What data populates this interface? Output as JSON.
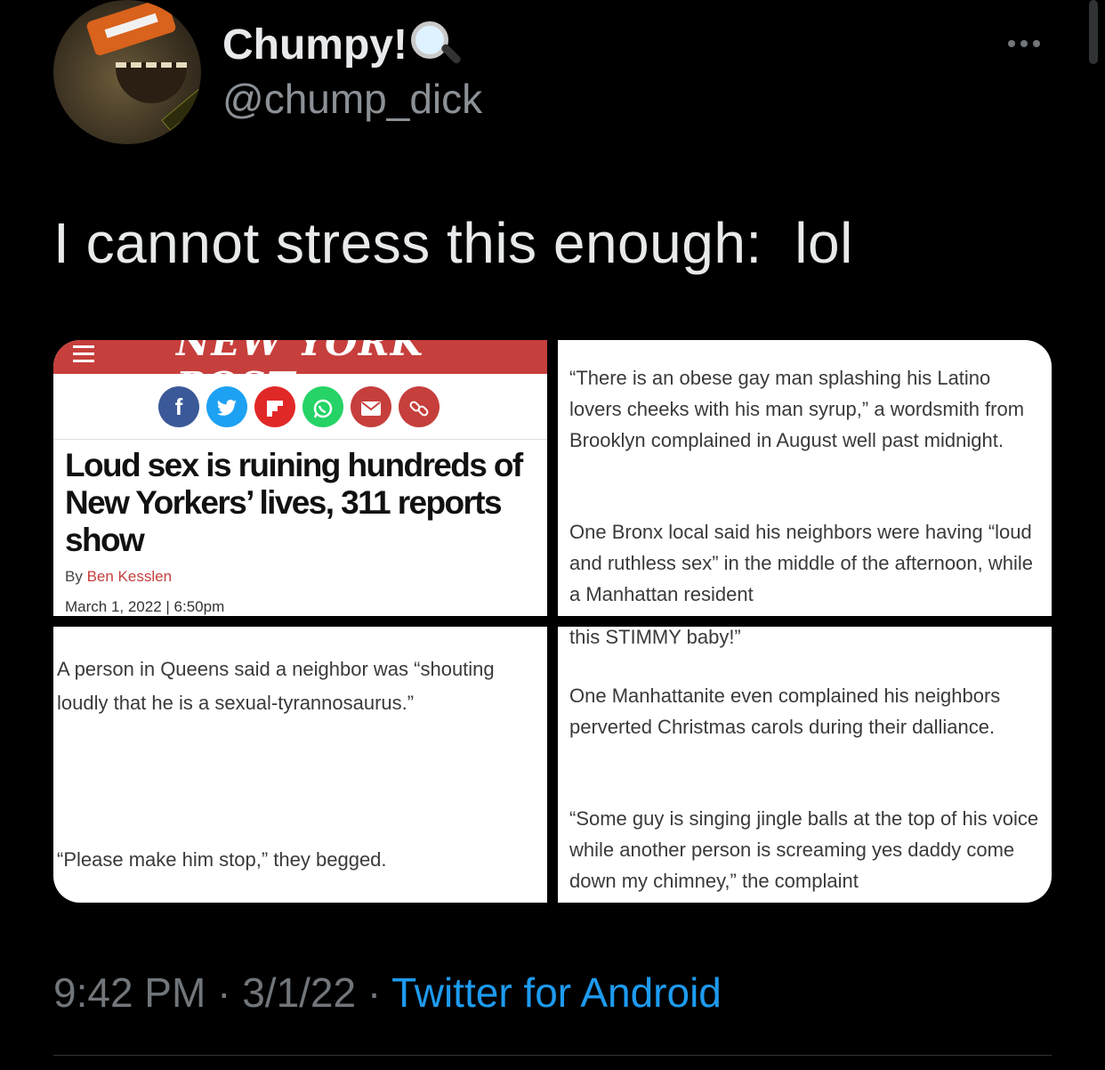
{
  "user": {
    "display_name": "Chumpy!",
    "handle": "@chump_dick"
  },
  "tweet": {
    "text": "I cannot stress this enough:  lol",
    "time": "9:42 PM",
    "date": "3/1/22",
    "separator": "·",
    "source": "Twitter for Android"
  },
  "article": {
    "publication": "NEW YORK POST",
    "headline": "Loud sex is ruining hundreds of New Yorkers’ lives, 311 reports show",
    "by_label": "By",
    "author": "Ben Kesslen",
    "dateline": "March 1, 2022 | 6:50pm",
    "share_icons": [
      "facebook-icon",
      "twitter-icon",
      "flipboard-icon",
      "whatsapp-icon",
      "email-icon",
      "link-icon"
    ]
  },
  "screenshots": {
    "panel2_p1": "“There is an obese gay man splashing his Latino lovers cheeks with his man syrup,” a wordsmith from Brooklyn complained in August well past midnight.",
    "panel2_p2": "One Bronx local said his neighbors were having “loud and ruthless sex” in the middle of the afternoon, while a Manhattan resident",
    "panel3_p1": "A person in Queens said a neighbor was “shouting loudly that he is a sexual-tyrannosaurus.”",
    "panel3_p2": "“Please make him stop,” they begged.",
    "panel4_p0": "this STIMMY baby!”",
    "panel4_p1": "One Manhattanite even complained his neighbors perverted Christmas carols during their dalliance.",
    "panel4_p2": "“Some guy is singing jingle balls at the top of his voice while another person is screaming yes daddy come down my chimney,” the complaint"
  }
}
